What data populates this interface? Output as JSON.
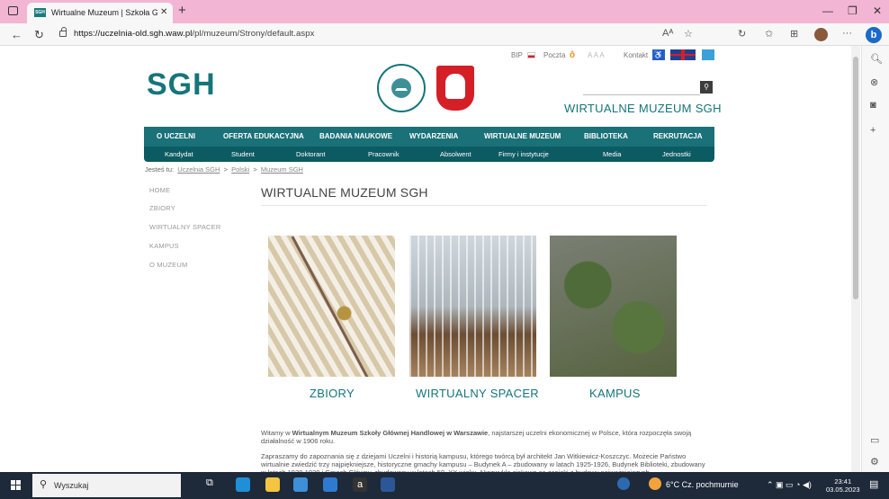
{
  "browser": {
    "tab_title": "Wirtualne Muzeum | Szkoła Głów",
    "tab_favicon": "SGH",
    "url_host": "https://uczelnia-old.sgh.waw.pl",
    "url_path": "/pl/muzeum/Strony/default.aspx"
  },
  "header": {
    "logo": "SGH",
    "toplinks": [
      "BIP",
      "Poczta",
      "A A A",
      "Kontakt"
    ],
    "site_title": "WIRTUALNE MUZEUM SGH"
  },
  "nav_primary": [
    "O UCZELNI",
    "OFERTA EDUKACYJNA",
    "BADANIA NAUKOWE",
    "WYDARZENIA",
    "WIRTUALNE MUZEUM",
    "BIBLIOTEKA",
    "REKRUTACJA"
  ],
  "nav_secondary": [
    "Kandydat",
    "Student",
    "Doktorant",
    "Pracownik",
    "Absolwent",
    "Firmy i instytucje",
    "Media",
    "Jednostki"
  ],
  "breadcrumb": {
    "prefix": "Jesteś tu:",
    "items": [
      "Uczelnia SGH",
      "Polski",
      "Muzeum SGH"
    ],
    "sep": ">"
  },
  "left_nav": [
    "HOME",
    "ZBIORY",
    "WIRTUALNY SPACER",
    "KAMPUS",
    "O MUZEUM"
  ],
  "main": {
    "title": "WIRTUALNE MUZEUM SGH",
    "cards": [
      "ZBIORY",
      "WIRTUALNY SPACER",
      "KAMPUS"
    ],
    "para1_a": "Witamy w ",
    "para1_b": "Wirtualnym Muzeum Szkoły Głównej Handlowej w Warszawie",
    "para1_c": ", najstarszej uczelni ekonomicznej w Polsce, która rozpoczęła swoją działalność w 1906 roku.",
    "para2": "Zapraszamy do zapoznania się z dziejami Uczelni i historią kampusu, którego twórcą był architekt Jan Witkiewicz-Koszczyc. Możecie Państwo wirtualnie zwiedzić trzy najpiękniejsze, historyczne gmachy kampusu – Budynek A – zbudowany w latach 1925-1926, Budynek Biblioteki, zbudowany w latach 1928-1930 i Gmach Główny, zbudowany w latach 50. XX wieku. Niezwykle ciekawe są zapiski z budowy najważniejszych"
  },
  "taskbar": {
    "search_placeholder": "Wyszukaj",
    "weather": "6°C Cz. pochmurnie",
    "time": "23:41",
    "date": "03.05.2023"
  },
  "colors": {
    "brand": "#15757a",
    "nav_primary": "#1a7178",
    "nav_secondary": "#0d5b62",
    "tabbar": "#f3b5d4"
  }
}
